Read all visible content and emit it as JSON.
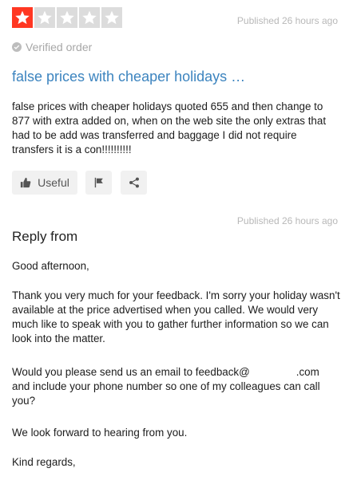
{
  "review": {
    "rating": 1,
    "max_rating": 5,
    "published": "Published 26 hours ago",
    "verified_label": "Verified order",
    "title": "false prices with cheaper holidays …",
    "body": "false prices with cheaper holidays quoted 655 and then change to 877 with extra added on, when on the web site the only extras that had to be add was transferred and baggage I did not require transfers it is a con!!!!!!!!!!",
    "useful_label": "Useful"
  },
  "colors": {
    "star_active": "#ff3722",
    "star_inactive": "#dcdcdc",
    "link": "#3c84bf"
  },
  "icons": [
    "thumbs-up-icon",
    "flag-icon",
    "share-icon",
    "check-circle-icon"
  ],
  "reply": {
    "published": "Published 26 hours ago",
    "title": "Reply from",
    "greeting": "Good afternoon,",
    "paragraph1": "Thank you very much for your feedback. I'm sorry your holiday wasn't available at the price advertised when you called. We would very much like to speak with you to gather further information so we can look into the matter.",
    "paragraph2_part1": "Would you please send us an email to feedback@",
    "paragraph2_part2": ".com",
    "paragraph2_part3": "and include your phone number so one of my colleagues can call you?",
    "paragraph3": "We look forward to hearing from you.",
    "signoff": "Kind regards,"
  }
}
